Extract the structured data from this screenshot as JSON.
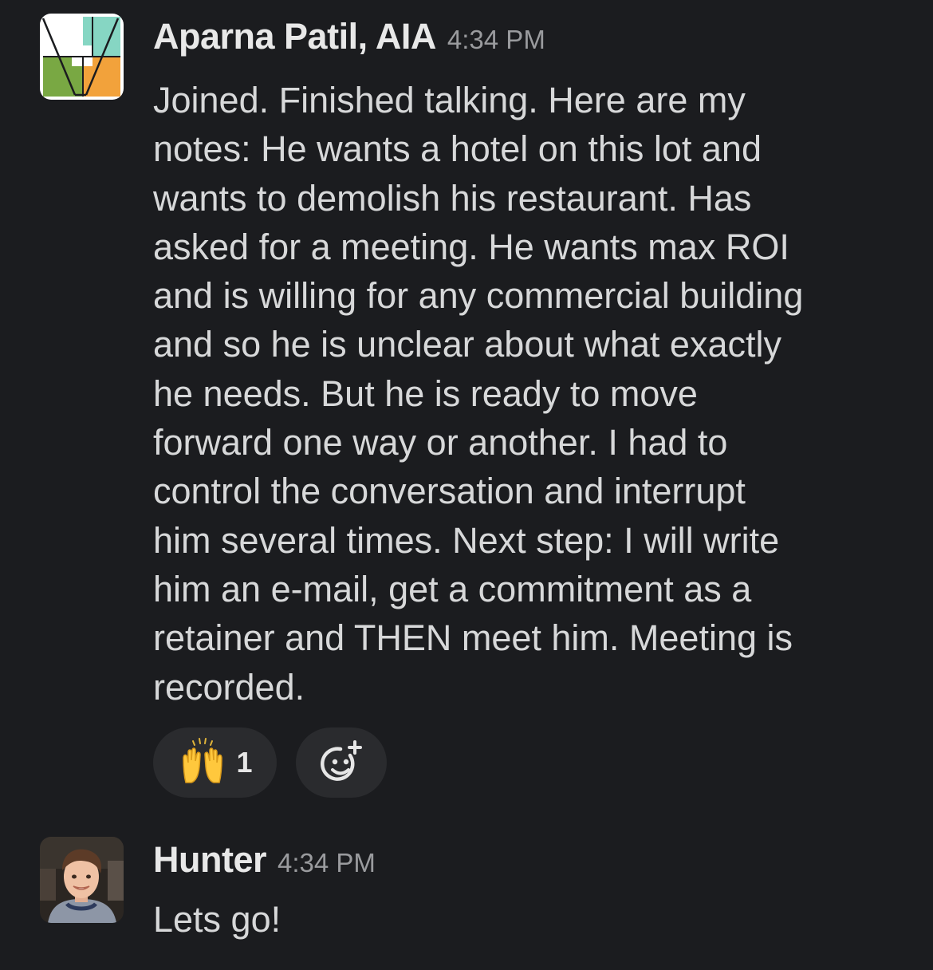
{
  "messages": [
    {
      "author": "Aparna Patil, AIA",
      "time": "4:34 PM",
      "avatar": "geometric-logo-avatar",
      "lines": [
        "Joined. Finished talking. Here are my",
        "notes: He wants a hotel on this lot and",
        "wants to demolish his restaurant. Has",
        "asked for a meeting. He wants max ROI",
        "and is willing for any commercial building",
        "and so he is unclear about what exactly",
        "he needs. But he is ready to move",
        "forward one way or another. I had to",
        "control the conversation and interrupt",
        "him several times. Next step: I will write",
        "him an e-mail, get a commitment as a",
        "retainer and THEN meet him. Meeting is",
        "recorded."
      ],
      "reactions": [
        {
          "emoji": "raising-hands-icon",
          "count": "1"
        }
      ],
      "add_reaction_icon": "add-reaction-icon"
    },
    {
      "author": "Hunter",
      "time": "4:34 PM",
      "avatar": "user-photo-avatar",
      "text": "Lets go!"
    }
  ],
  "colors": {
    "background": "#1b1c1f",
    "reaction_pill": "#2a2b2e",
    "timestamp": "#9a9b9e",
    "text": "#d7d8d9"
  }
}
